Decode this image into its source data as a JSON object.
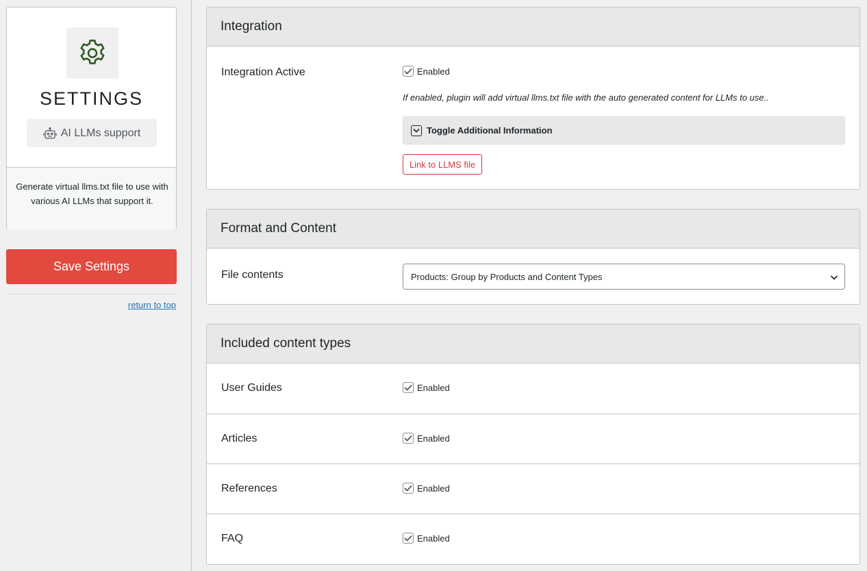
{
  "sidebar": {
    "icon": "gear-icon",
    "title": "SETTINGS",
    "badge_icon": "robot-icon",
    "badge_label": "AI LLMs support",
    "description": "Generate virtual llms.txt file to use with various AI LLMs that support it.",
    "save_label": "Save Settings",
    "return_top_label": "return to top"
  },
  "integration": {
    "header": "Integration",
    "active_label": "Integration Active",
    "enabled_label": "Enabled",
    "help_text": "If enabled, plugin will add virtual llms.txt file with the auto generated content for LLMs to use..",
    "toggle_label": "Toggle Additional Information",
    "link_label": "Link to LLMS file"
  },
  "format": {
    "header": "Format and Content",
    "file_contents_label": "File contents",
    "selected_option": "Products: Group by Products and Content Types"
  },
  "content_types": {
    "header": "Included content types",
    "rows": [
      {
        "label": "User Guides",
        "enabled_label": "Enabled",
        "checked": true
      },
      {
        "label": "Articles",
        "enabled_label": "Enabled",
        "checked": true
      },
      {
        "label": "References",
        "enabled_label": "Enabled",
        "checked": true
      },
      {
        "label": "FAQ",
        "enabled_label": "Enabled",
        "checked": true
      }
    ]
  },
  "colors": {
    "accent_red": "#e2493f",
    "gear_green": "#2b5a1e",
    "link_blue": "#2271b1"
  }
}
